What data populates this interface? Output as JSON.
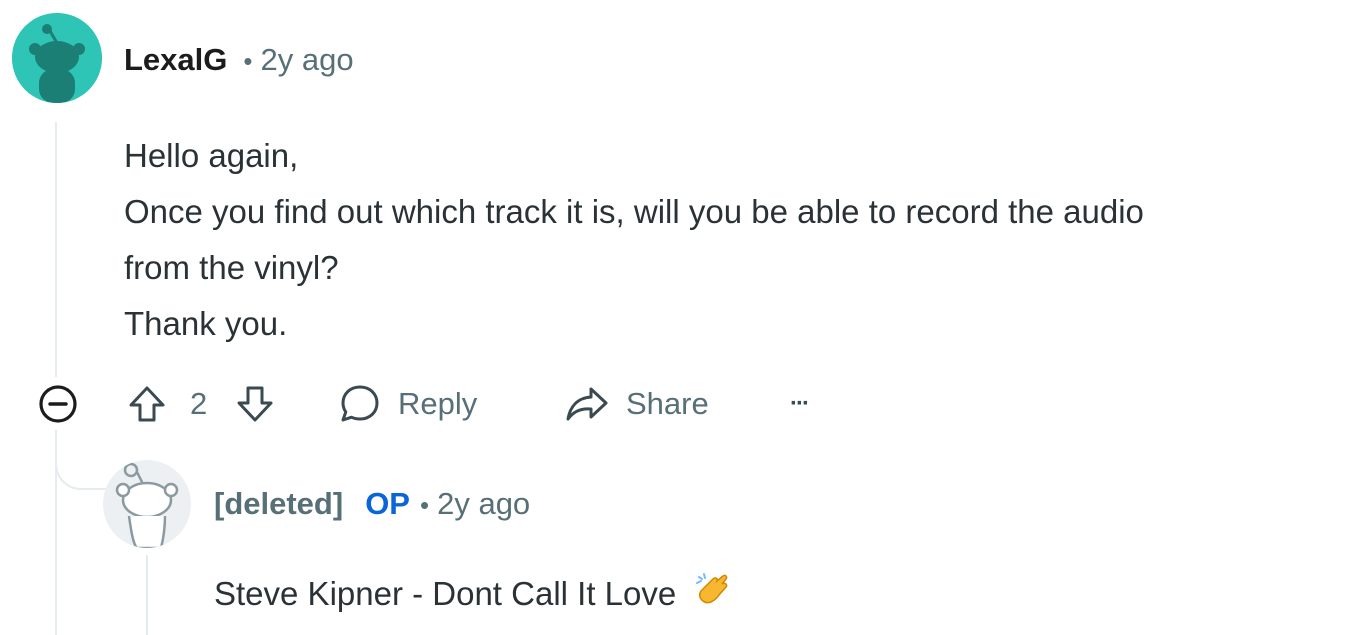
{
  "comment": {
    "username": "LexalG",
    "separator": "•",
    "time": "2y ago",
    "avatar_color": "#2ec4b6",
    "body_lines": [
      "Hello again,",
      "Once you find out which track it is, will you be able to record the audio",
      "from the vinyl?",
      "Thank you."
    ],
    "actions": {
      "collapse_icon": "collapse-minus-icon",
      "upvote_icon": "upvote-arrow-icon",
      "vote_count": "2",
      "downvote_icon": "downvote-arrow-icon",
      "reply_label": "Reply",
      "share_label": "Share",
      "more_label": "···"
    }
  },
  "reply": {
    "username": "[deleted]",
    "op_badge": "OP",
    "separator": "•",
    "time": "2y ago",
    "body": "Steve Kipner - Dont Call It Love",
    "emoji_icon": "clapping-hand-emoji",
    "op_color": "#0a66d8"
  }
}
